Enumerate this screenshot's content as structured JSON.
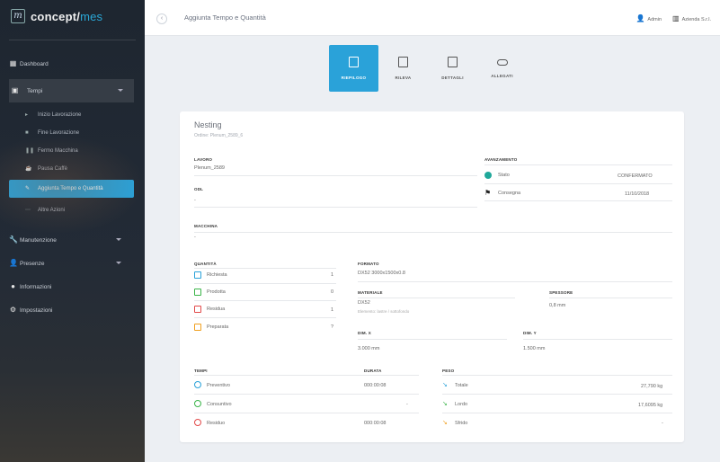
{
  "brand": {
    "mark": "m",
    "name": "concept/",
    "suffix": "mes"
  },
  "sidebar": {
    "items": [
      {
        "label": "Dashboard",
        "icon": "grid-icon"
      },
      {
        "label": "Tempi",
        "icon": "calendar-icon",
        "open": true,
        "subitems": [
          {
            "label": "Inizio Lavorazione",
            "icon": "play-icon"
          },
          {
            "label": "Fine Lavorazione",
            "icon": "stop-icon"
          },
          {
            "label": "Fermo Macchina",
            "icon": "pause-icon"
          },
          {
            "label": "Pausa Caffè",
            "icon": "coffee-icon"
          },
          {
            "label": "Aggiunta Tempo e Quantità",
            "icon": "edit-icon",
            "active": true
          },
          {
            "label": "Altre Azioni",
            "icon": "more-icon"
          }
        ]
      },
      {
        "label": "Manutenzione",
        "icon": "wrench-icon"
      },
      {
        "label": "Presenze",
        "icon": "user-icon"
      },
      {
        "label": "Informazioni",
        "icon": "info-icon"
      },
      {
        "label": "Impostazioni",
        "icon": "gear-icon"
      }
    ]
  },
  "topbar": {
    "breadcrumb": "Aggiunta Tempo e Quantità",
    "user_label": "Admin",
    "company_label": "Azienda S.r.l."
  },
  "steps": [
    {
      "label": "RIEPILOGO",
      "icon": "clipboard-icon",
      "active": true
    },
    {
      "label": "RILEVA",
      "icon": "input-icon"
    },
    {
      "label": "DETTAGLI",
      "icon": "details-icon"
    },
    {
      "label": "ALLEGATI",
      "icon": "attachment-icon"
    }
  ],
  "card": {
    "title": "Nesting",
    "subtitle": "Ordine: Plenum_2589_6",
    "lavoro_label": "LAVORO",
    "lavoro_value": "Plenum_2589",
    "odl_label": "ODL",
    "odl_value": "-",
    "macchina_label": "MACCHINA",
    "macchina_value": "-",
    "avanzamento_label": "AVANZAMENTO",
    "stato_label": "Stato",
    "stato_value": "CONFERMATO",
    "stato_color": "#1fa89a",
    "consegna_label": "Consegna",
    "consegna_value": "11/10/2018",
    "quantita_label": "QUANTITÀ",
    "quantita": [
      {
        "label": "Richiesta",
        "value": "1",
        "color": "#2aa2d9"
      },
      {
        "label": "Prodotta",
        "value": "0",
        "color": "#3bb54a"
      },
      {
        "label": "Residua",
        "value": "1",
        "color": "#e24a4a"
      },
      {
        "label": "Preparata",
        "value": "?",
        "color": "#f0a020"
      }
    ],
    "formato_label": "FORMATO",
    "formato_value": "DX52 3000x1500x0.8",
    "materiale_label": "MATERIALE",
    "materiale_value": "DX52",
    "materiale_note": "Elemento: lastre / sottofondo",
    "spessore_label": "SPESSORE",
    "spessore_value": "0,8 mm",
    "dimx_label": "DIM. X",
    "dimx_value": "3.000 mm",
    "dimy_label": "DIM. Y",
    "dimy_value": "1.500 mm",
    "tempi_label": "TEMPI",
    "durata_label": "DURATA",
    "tempi": [
      {
        "label": "Preventivo",
        "value": "000:00:08",
        "color": "#2aa2d9"
      },
      {
        "label": "Consuntivo",
        "value": "-",
        "color": "#3bb54a"
      },
      {
        "label": "Residuo",
        "value": "000:00:08",
        "color": "#e24a4a"
      }
    ],
    "pesi_label": "PESO",
    "pesi": [
      {
        "label": "Totale",
        "value": "27,790 kg",
        "color": "#2aa2d9"
      },
      {
        "label": "Lordo",
        "value": "17,6095 kg",
        "color": "#3bb54a"
      },
      {
        "label": "Sfrido",
        "value": "-",
        "color": "#f0a020"
      }
    ]
  }
}
